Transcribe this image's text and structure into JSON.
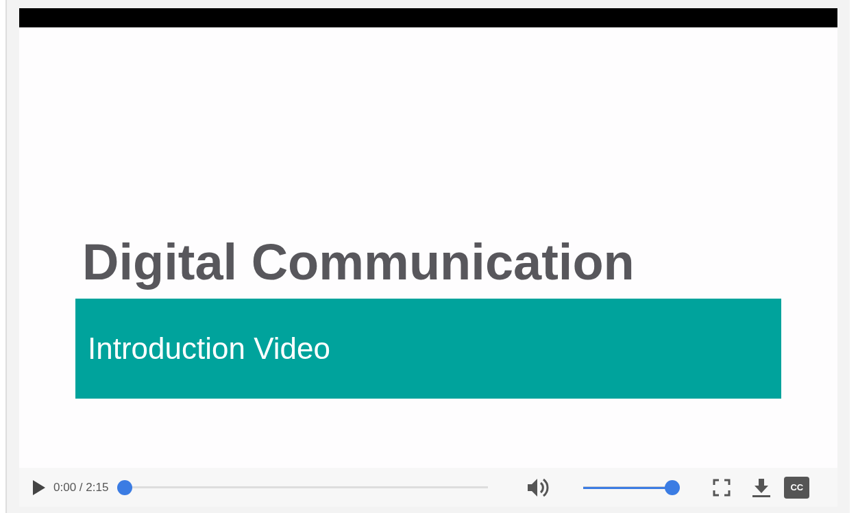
{
  "slide": {
    "title": "Digital Communication",
    "subtitle": "Introduction Video"
  },
  "controls": {
    "playing": false,
    "time": "0:00 / 2:15",
    "progress": {
      "level": 0
    },
    "volume": {
      "level": 1,
      "muted": false
    },
    "captions_label": "CC"
  }
}
